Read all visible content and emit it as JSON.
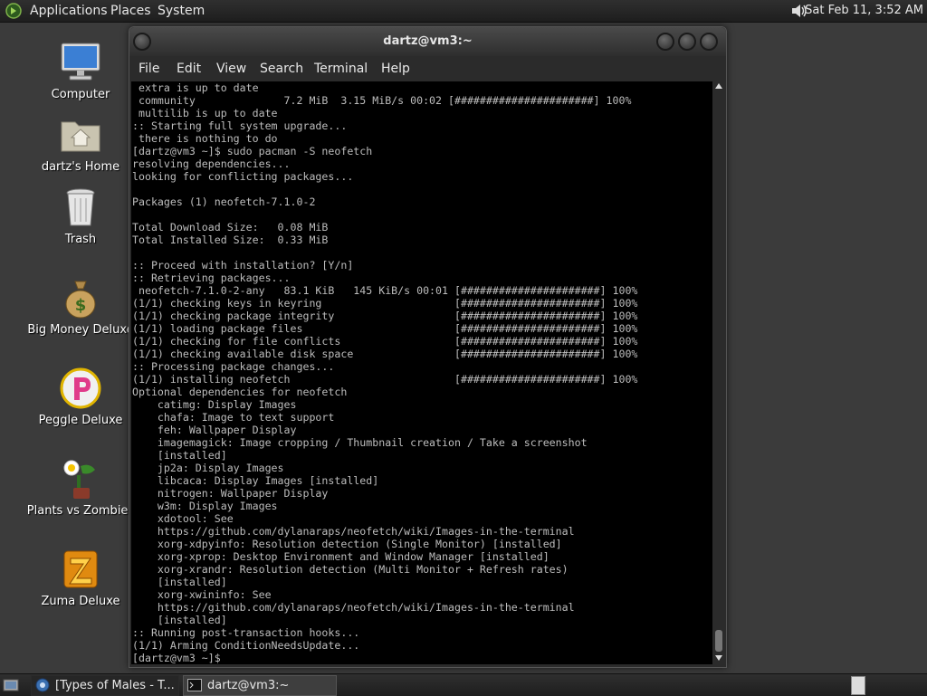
{
  "top_panel": {
    "menus": [
      "Applications",
      "Places",
      "System"
    ],
    "clock": "Sat Feb 11,  3:52 AM",
    "logo_icon": "gnome-foot-icon",
    "volume_icon": "speaker-icon"
  },
  "desktop_icons": [
    {
      "label": "Computer",
      "icon": "computer-icon"
    },
    {
      "label": "dartz's Home",
      "icon": "home-folder-icon"
    },
    {
      "label": "Trash",
      "icon": "trash-icon"
    },
    {
      "label": "Big Money Deluxe",
      "icon": "money-bag-icon"
    },
    {
      "label": "Peggle Deluxe",
      "icon": "peggle-icon"
    },
    {
      "label": "Plants vs Zombies",
      "icon": "plants-icon"
    },
    {
      "label": "Zuma Deluxe",
      "icon": "zuma-icon"
    }
  ],
  "terminal": {
    "title": "dartz@vm3:~",
    "menus": [
      "File",
      "Edit",
      "View",
      "Search",
      "Terminal",
      "Help"
    ],
    "lines": [
      " extra is up to date",
      " community              7.2 MiB  3.15 MiB/s 00:02 [######################] 100%",
      " multilib is up to date",
      ":: Starting full system upgrade...",
      " there is nothing to do",
      "[dartz@vm3 ~]$ sudo pacman -S neofetch",
      "resolving dependencies...",
      "looking for conflicting packages...",
      "",
      "Packages (1) neofetch-7.1.0-2",
      "",
      "Total Download Size:   0.08 MiB",
      "Total Installed Size:  0.33 MiB",
      "",
      ":: Proceed with installation? [Y/n]",
      ":: Retrieving packages...",
      " neofetch-7.1.0-2-any   83.1 KiB   145 KiB/s 00:01 [######################] 100%",
      "(1/1) checking keys in keyring                     [######################] 100%",
      "(1/1) checking package integrity                   [######################] 100%",
      "(1/1) loading package files                        [######################] 100%",
      "(1/1) checking for file conflicts                  [######################] 100%",
      "(1/1) checking available disk space                [######################] 100%",
      ":: Processing package changes...",
      "(1/1) installing neofetch                          [######################] 100%",
      "Optional dependencies for neofetch",
      "    catimg: Display Images",
      "    chafa: Image to text support",
      "    feh: Wallpaper Display",
      "    imagemagick: Image cropping / Thumbnail creation / Take a screenshot",
      "    [installed]",
      "    jp2a: Display Images",
      "    libcaca: Display Images [installed]",
      "    nitrogen: Wallpaper Display",
      "    w3m: Display Images",
      "    xdotool: See",
      "    https://github.com/dylanaraps/neofetch/wiki/Images-in-the-terminal",
      "    xorg-xdpyinfo: Resolution detection (Single Monitor) [installed]",
      "    xorg-xprop: Desktop Environment and Window Manager [installed]",
      "    xorg-xrandr: Resolution detection (Multi Monitor + Refresh rates)",
      "    [installed]",
      "    xorg-xwininfo: See",
      "    https://github.com/dylanaraps/neofetch/wiki/Images-in-the-terminal",
      "    [installed]",
      ":: Running post-transaction hooks...",
      "(1/1) Arming ConditionNeedsUpdate...",
      "[dartz@vm3 ~]$ "
    ]
  },
  "taskbar": {
    "tasks": [
      {
        "label": "[Types of Males - T...",
        "icon": "browser-icon"
      },
      {
        "label": "dartz@vm3:~",
        "icon": "terminal-icon"
      }
    ]
  }
}
